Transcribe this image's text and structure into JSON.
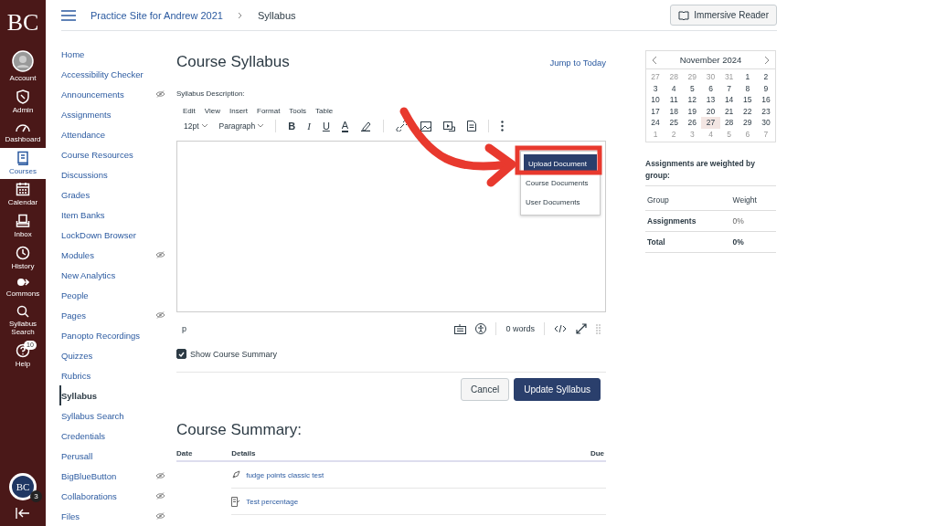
{
  "global_nav": {
    "logo": "BC",
    "items": [
      {
        "label": "Account",
        "selected": false
      },
      {
        "label": "Admin",
        "selected": false
      },
      {
        "label": "Dashboard",
        "selected": false
      },
      {
        "label": "Courses",
        "selected": true
      },
      {
        "label": "Calendar",
        "selected": false
      },
      {
        "label": "Inbox",
        "selected": false
      },
      {
        "label": "History",
        "selected": false
      },
      {
        "label": "Commons",
        "selected": false
      },
      {
        "label": "Syllabus Search",
        "selected": false
      },
      {
        "label": "Help",
        "selected": false,
        "badge": "10"
      }
    ],
    "user": {
      "initials": "BC",
      "badge": "3"
    }
  },
  "header": {
    "breadcrumb": [
      "Practice Site for Andrew 2021",
      "Syllabus"
    ],
    "button": "Immersive Reader"
  },
  "course_nav": [
    {
      "label": "Home",
      "hidden": false,
      "selected": false
    },
    {
      "label": "Accessibility Checker",
      "hidden": false,
      "selected": false
    },
    {
      "label": "Announcements",
      "hidden": true,
      "selected": false
    },
    {
      "label": "Assignments",
      "hidden": false,
      "selected": false
    },
    {
      "label": "Attendance",
      "hidden": false,
      "selected": false
    },
    {
      "label": "Course Resources",
      "hidden": false,
      "selected": false
    },
    {
      "label": "Discussions",
      "hidden": false,
      "selected": false
    },
    {
      "label": "Grades",
      "hidden": false,
      "selected": false
    },
    {
      "label": "Item Banks",
      "hidden": false,
      "selected": false
    },
    {
      "label": "LockDown Browser",
      "hidden": false,
      "selected": false
    },
    {
      "label": "Modules",
      "hidden": true,
      "selected": false
    },
    {
      "label": "New Analytics",
      "hidden": false,
      "selected": false
    },
    {
      "label": "People",
      "hidden": false,
      "selected": false
    },
    {
      "label": "Pages",
      "hidden": true,
      "selected": false
    },
    {
      "label": "Panopto Recordings",
      "hidden": false,
      "selected": false
    },
    {
      "label": "Quizzes",
      "hidden": false,
      "selected": false
    },
    {
      "label": "Rubrics",
      "hidden": false,
      "selected": false
    },
    {
      "label": "Syllabus",
      "hidden": false,
      "selected": true
    },
    {
      "label": "Syllabus Search",
      "hidden": false,
      "selected": false
    },
    {
      "label": "Credentials",
      "hidden": false,
      "selected": false
    },
    {
      "label": "Perusall",
      "hidden": false,
      "selected": false
    },
    {
      "label": "BigBlueButton",
      "hidden": true,
      "selected": false
    },
    {
      "label": "Collaborations",
      "hidden": true,
      "selected": false
    },
    {
      "label": "Files",
      "hidden": true,
      "selected": false
    }
  ],
  "content": {
    "title": "Course Syllabus",
    "jump": "Jump to Today",
    "description_label": "Syllabus Description:",
    "menubar": [
      "Edit",
      "View",
      "Insert",
      "Format",
      "Tools",
      "Table"
    ],
    "toolbar": {
      "font_size": "12pt",
      "block": "Paragraph",
      "format": [
        {
          "label": "B",
          "kind": "bold"
        },
        {
          "label": "I",
          "kind": "italic"
        },
        {
          "label": "U",
          "kind": "underline"
        },
        {
          "label": "A",
          "kind": "color"
        }
      ]
    },
    "menu": [
      {
        "label": "Upload Document",
        "selected": true
      },
      {
        "label": "Course Documents",
        "selected": false
      },
      {
        "label": "User Documents",
        "selected": false
      }
    ],
    "status": {
      "path": "p",
      "words": "0 words"
    },
    "show_summary": {
      "label": "Show Course Summary",
      "checked": true
    },
    "buttons": {
      "cancel": "Cancel",
      "submit": "Update Syllabus"
    },
    "summary": {
      "title": "Course Summary:",
      "columns": [
        "Date",
        "Details",
        "Due"
      ],
      "rows": [
        {
          "kind": "quiz",
          "details": "fudge points classic test"
        },
        {
          "kind": "assignment",
          "details": "Test percentage"
        }
      ]
    }
  },
  "calendar": {
    "title": "November 2024",
    "days": [
      {
        "d": "27",
        "muted": true
      },
      {
        "d": "28",
        "muted": true
      },
      {
        "d": "29",
        "muted": true
      },
      {
        "d": "30",
        "muted": true
      },
      {
        "d": "31",
        "muted": true
      },
      {
        "d": "1",
        "muted": false
      },
      {
        "d": "2",
        "muted": false
      },
      {
        "d": "3",
        "muted": false
      },
      {
        "d": "4",
        "muted": false
      },
      {
        "d": "5",
        "muted": false
      },
      {
        "d": "6",
        "muted": false
      },
      {
        "d": "7",
        "muted": false
      },
      {
        "d": "8",
        "muted": false
      },
      {
        "d": "9",
        "muted": false
      },
      {
        "d": "10",
        "muted": false
      },
      {
        "d": "11",
        "muted": false
      },
      {
        "d": "12",
        "muted": false
      },
      {
        "d": "13",
        "muted": false
      },
      {
        "d": "14",
        "muted": false
      },
      {
        "d": "15",
        "muted": false
      },
      {
        "d": "16",
        "muted": false
      },
      {
        "d": "17",
        "muted": false
      },
      {
        "d": "18",
        "muted": false
      },
      {
        "d": "19",
        "muted": false
      },
      {
        "d": "20",
        "muted": false
      },
      {
        "d": "21",
        "muted": false
      },
      {
        "d": "22",
        "muted": false
      },
      {
        "d": "23",
        "muted": false
      },
      {
        "d": "24",
        "muted": false
      },
      {
        "d": "25",
        "muted": false
      },
      {
        "d": "26",
        "muted": false
      },
      {
        "d": "27",
        "muted": false,
        "today": true
      },
      {
        "d": "28",
        "muted": false
      },
      {
        "d": "29",
        "muted": false
      },
      {
        "d": "30",
        "muted": false
      },
      {
        "d": "1",
        "muted": true
      },
      {
        "d": "2",
        "muted": true
      },
      {
        "d": "3",
        "muted": true
      },
      {
        "d": "4",
        "muted": true
      },
      {
        "d": "5",
        "muted": true
      },
      {
        "d": "6",
        "muted": true
      },
      {
        "d": "7",
        "muted": true
      }
    ]
  },
  "weights": {
    "intro": "Assignments are weighted by group:",
    "columns": [
      "Group",
      "Weight"
    ],
    "rows": [
      {
        "group": "Assignments",
        "weight": "0%",
        "total": false
      },
      {
        "group": "Total",
        "weight": "0%",
        "total": true
      }
    ]
  }
}
